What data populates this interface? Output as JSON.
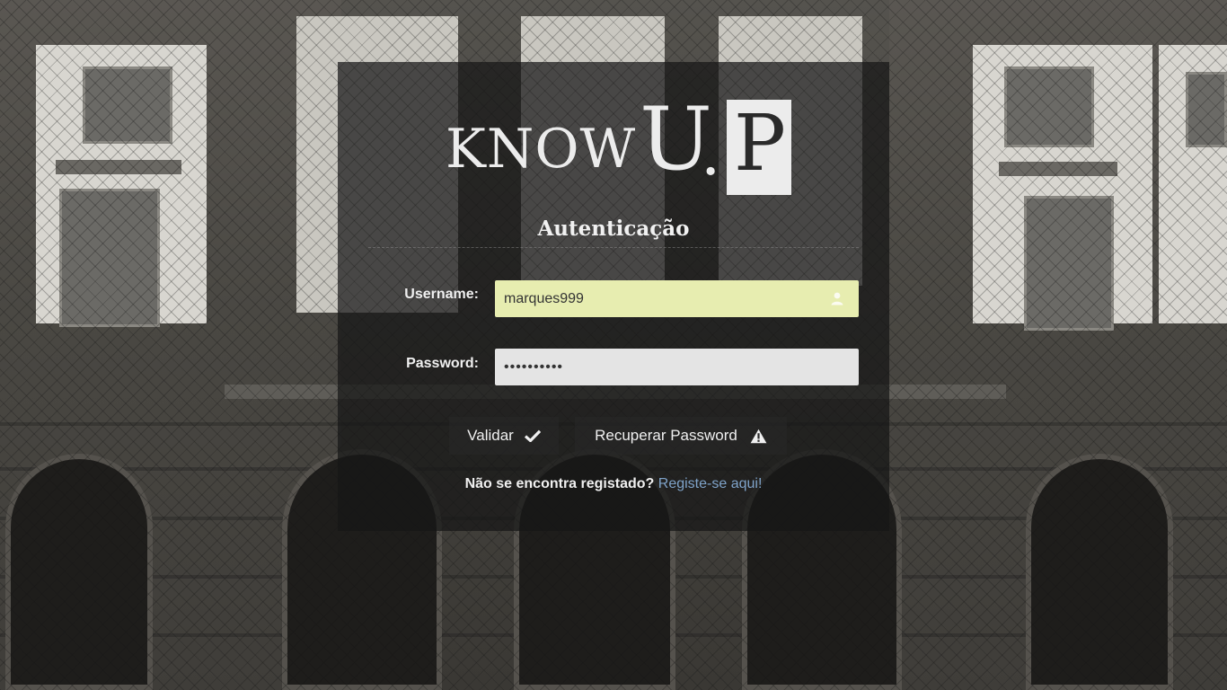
{
  "page": {
    "logo": {
      "know": "KNOW",
      "u": "U",
      "dot": ".",
      "p": "P"
    },
    "title": "Autenticação"
  },
  "form": {
    "username_label": "Username:",
    "username_value": "marques999",
    "password_label": "Password:",
    "password_value": "••••••••••"
  },
  "actions": {
    "validate_label": "Validar",
    "recover_label": "Recuperar Password"
  },
  "register": {
    "prompt": "Não se encontra registado?",
    "link_text": "Registe-se aqui!"
  },
  "icons": {
    "validate": "check-icon",
    "recover": "warning-icon",
    "username": "user-icon"
  },
  "colors": {
    "username_field_bg": "#e7edb0",
    "password_field_bg": "#e4e4e4",
    "link": "#7fa3c9",
    "panel_bg": "rgba(22,22,22,0.72)"
  }
}
